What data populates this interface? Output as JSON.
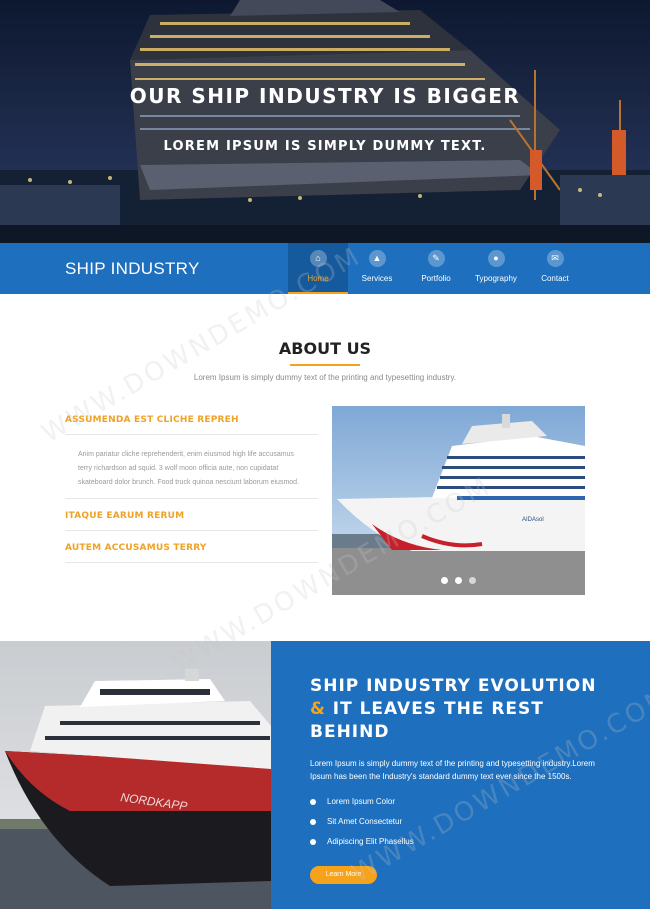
{
  "hero": {
    "title": "OUR SHIP INDUSTRY IS BIGGER",
    "subtitle": "LOREM IPSUM IS SIMPLY DUMMY TEXT."
  },
  "navbar": {
    "brand": "SHIP INDUSTRY",
    "items": [
      {
        "label": "Home",
        "icon": "home-icon",
        "active": true
      },
      {
        "label": "Services",
        "icon": "flask-icon",
        "active": false
      },
      {
        "label": "Portfolio",
        "icon": "pencil-icon",
        "active": false
      },
      {
        "label": "Typography",
        "icon": "users-icon",
        "active": false
      },
      {
        "label": "Contact",
        "icon": "envelope-icon",
        "active": false
      }
    ],
    "accent": "#f7a21b",
    "bar_color": "#1e6fbd"
  },
  "about": {
    "title": "ABOUT US",
    "subtitle": "Lorem Ipsum is simply dummy text of the printing and typesetting industry.",
    "accordion": [
      {
        "title": "ASSUMENDA EST CLICHE REPREH",
        "body": "Anim pariatur cliche reprehenderit, enim eiusmod high life accusamus terry richardson ad squid. 3 wolf moon officia aute, non cupidatat skateboard dolor brunch. Food truck quinoa nesciunt laborum eiusmod."
      },
      {
        "title": "ITAQUE EARUM RERUM"
      },
      {
        "title": "AUTEM ACCUSAMUS TERRY"
      }
    ],
    "slider": {
      "ship_name": "AIDAsol",
      "active_dot": 2
    }
  },
  "evolution": {
    "heading_line1": "SHIP INDUSTRY EVOLUTION",
    "heading_amp": "&",
    "heading_line2": "IT LEAVES THE REST",
    "heading_line3": "BEHIND",
    "text": "Lorem Ipsum is simply dummy text of the printing and typesetting industry.Lorem Ipsum has been the Industry's standard dummy text ever since the 1500s.",
    "list": [
      "Lorem Ipsum Color",
      "Sit Amet Consectetur",
      "Adipiscing Elit Phasellus"
    ],
    "button": "Learn More",
    "ship_name": "NORDKAPP"
  },
  "watermark": "WWW.DOWNDEMO.COM"
}
